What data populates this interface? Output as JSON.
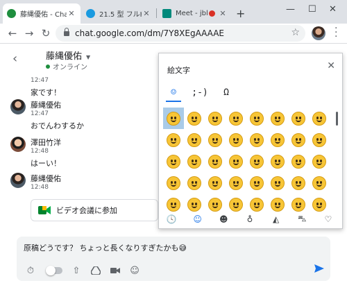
{
  "browser": {
    "tabs": [
      {
        "title": "藤縄優佑 - Cha",
        "favicon_color": "#1e8e3e",
        "active": true
      },
      {
        "title": "21.5 型 フルHD",
        "favicon_color": "#1a9ae0",
        "active": false
      },
      {
        "title": "Meet - jbl",
        "favicon_color": "#00897b",
        "active": false
      }
    ],
    "url": "chat.google.com/dm/7Y8XEgAAAAE"
  },
  "chat": {
    "header": {
      "name": "藤縄優佑",
      "status": "オンライン"
    },
    "messages": [
      {
        "name": "",
        "time": "12:47",
        "text": "家です！"
      },
      {
        "name": "藤縄優佑",
        "time": "12:47",
        "text": "おでんわするか"
      },
      {
        "name": "澤田竹洋",
        "time": "12:48",
        "text": "はーい！"
      },
      {
        "name": "藤縄優佑",
        "time": "12:48",
        "text": ""
      }
    ],
    "meet_card": {
      "label": "ビデオ会議に参加"
    },
    "compose": {
      "value": "原稿どうです？ ちょっと長くなりすぎたかも😅"
    }
  },
  "emoji_panel": {
    "title": "絵文字",
    "tabs": [
      "☺",
      ";-)",
      "Ω"
    ],
    "emoji_count": 40,
    "category_icons": [
      "clock-icon",
      "smiley-icon",
      "person-icon",
      "balloon-icon",
      "pizza-icon",
      "car-icon",
      "heart-icon"
    ]
  }
}
